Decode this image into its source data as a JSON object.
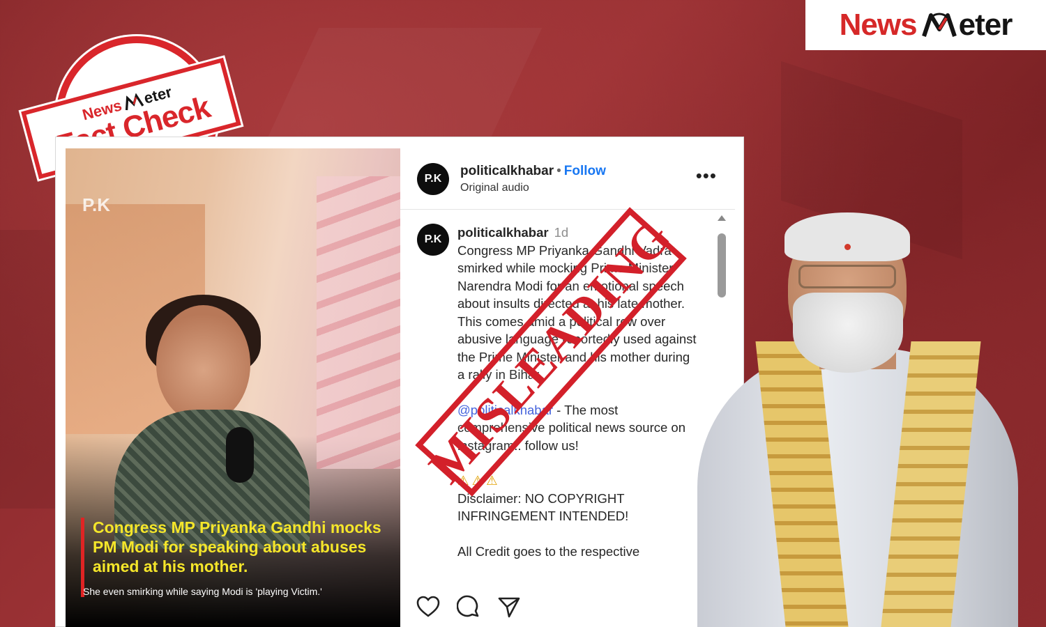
{
  "brand": {
    "news": "News",
    "meter": "eter"
  },
  "stamp_fact_check": {
    "small_news": "News",
    "small_meter": "eter",
    "big": "Fact Check"
  },
  "post": {
    "video": {
      "watermark": "P.K",
      "headline": "Congress MP Priyanka Gandhi mocks PM Modi for speaking about abuses aimed at his mother.",
      "subcaption": "She even smirking while saying Modi is 'playing Victim.'"
    },
    "header": {
      "avatar": "P.K",
      "username": "politicalkhabar",
      "separator": "•",
      "follow": "Follow",
      "audio": "Original audio",
      "more": "•••"
    },
    "comment": {
      "avatar": "P.K",
      "username": "politicalkhabar",
      "time": "1d",
      "body": "Congress MP Priyanka Gandhi Vadra smirked while mocking Prime Minister Narendra Modi for an emotional speech about insults directed at his late mother. This comes amid a political row over abusive language reportedly used against the Prime Minister and his mother during a rally in Bihar.",
      "mention": "@politicalkhabar",
      "promo": " - The most comprehensive political news source on instagram.. follow us!",
      "warnings": "⚠⚠⚠",
      "disclaimer": "Disclaimer: NO COPYRIGHT INFRINGEMENT INTENDED!",
      "credit": "All Credit goes to the respective"
    },
    "actions": [
      "like-icon",
      "comment-icon",
      "share-icon"
    ]
  },
  "verdict_stamp": "MISLEADING",
  "colors": {
    "brand_red": "#d62828",
    "link_blue": "#1877f2",
    "stamp_red": "#d3202a",
    "caption_yellow": "#f5e62a"
  }
}
